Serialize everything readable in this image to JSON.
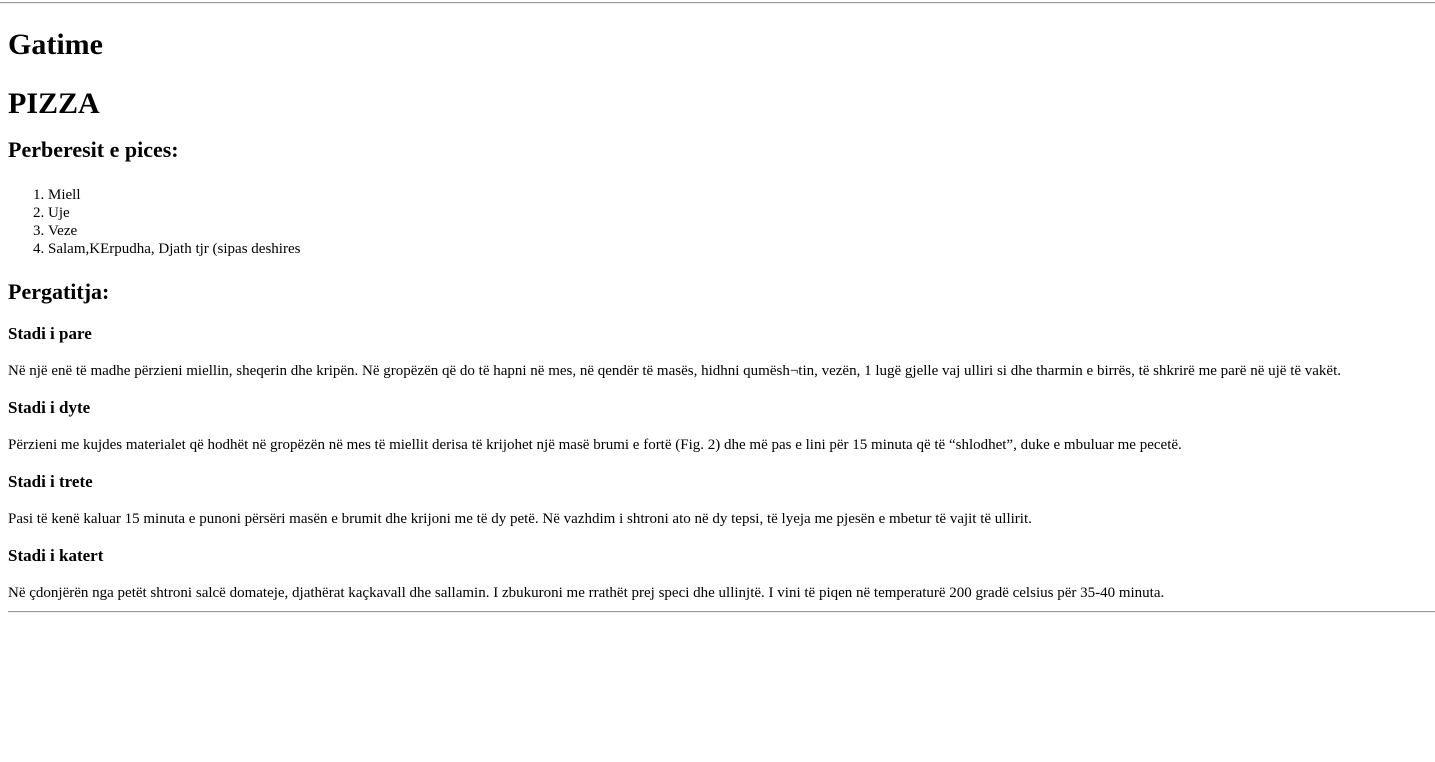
{
  "site": {
    "title": "Gatime"
  },
  "recipe": {
    "title": "PIZZA",
    "ingredients_heading": "Perberesit e pices:",
    "ingredients": [
      "Miell",
      "Uje",
      "Veze",
      "Salam,KErpudha, Djath tjr (sipas deshires"
    ],
    "preparation_heading": "Pergatitja:",
    "steps": [
      {
        "title": "Stadi i pare",
        "text": "Në një enë të madhe përzieni miellin, sheqerin dhe kripën. Në gropëzën që do të hapni në mes, në qendër të masës, hidhni qumësh¬tin, vezën, 1 lugë gjelle vaj ulliri si dhe tharmin e birrës, të shkrirë me parë në ujë të vakët."
      },
      {
        "title": "Stadi i dyte",
        "text": "Përzieni me kujdes materialet që hodhët në gropëzën në mes të miellit derisa të krijohet një masë brumi e fortë (Fig. 2) dhe më pas e lini për 15 minuta që të “shlodhet”, duke e mbuluar me pecetë."
      },
      {
        "title": "Stadi i trete",
        "text": "Pasi të kenë kaluar 15 minuta e punoni përsëri masën e brumit dhe krijoni me të dy petë. Në vazhdim i shtroni ato në dy tepsi, të lyeja me pjesën e mbetur të vajit të ullirit."
      },
      {
        "title": "Stadi i katert",
        "text": "Në çdonjërën nga petët shtroni salcë domateje, djathërat kaçkavall dhe sallamin. I zbukuroni me rrathët prej speci dhe ullinjtë. I vini të piqen në temperaturë 200 gradë celsius për 35-40 minuta."
      }
    ]
  }
}
